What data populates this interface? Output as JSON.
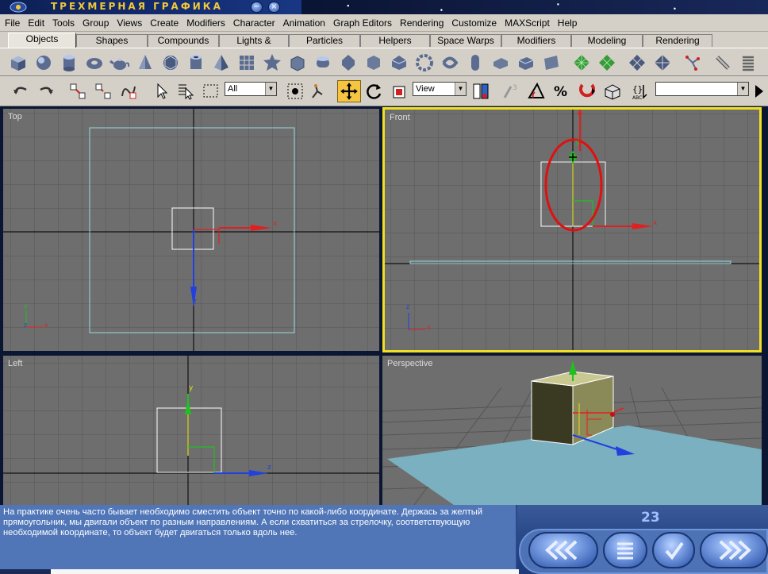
{
  "window": {
    "title": "ТРЕХМЕРНАЯ ГРАФИКА",
    "min_label": "−",
    "close_label": "×"
  },
  "menu": [
    "File",
    "Edit",
    "Tools",
    "Group",
    "Views",
    "Create",
    "Modifiers",
    "Character",
    "Animation",
    "Graph Editors",
    "Rendering",
    "Customize",
    "MAXScript",
    "Help"
  ],
  "tabs": [
    {
      "label": "Objects",
      "active": true
    },
    {
      "label": "Shapes"
    },
    {
      "label": "Compounds"
    },
    {
      "label": "Lights & Cameras"
    },
    {
      "label": "Particles"
    },
    {
      "label": "Helpers"
    },
    {
      "label": "Space Warps"
    },
    {
      "label": "Modifiers"
    },
    {
      "label": "Modeling"
    },
    {
      "label": "Rendering"
    }
  ],
  "icons": [
    "box-icon",
    "sphere-icon",
    "cylinder-icon",
    "torus-icon",
    "teapot-icon",
    "cone-icon",
    "geosphere-icon",
    "tube-icon",
    "pyramid-icon",
    "plane-icon",
    "hedra-icon",
    "chamferbox-icon",
    "oiltank-icon",
    "spindle-icon",
    "gengon-icon",
    "prism-icon",
    "torusknot-icon",
    "ringwave-icon",
    "hose-icon",
    "capsule-icon",
    "l-ext-icon",
    "c-ext-icon",
    "wall-icon",
    "grid-icon",
    "grid2-icon",
    "patch-icon",
    "patch2-icon",
    "bones-icon",
    "pencil-icon",
    "spring-icon"
  ],
  "toolbar": {
    "filter_value": "All",
    "refcoord_value": "View",
    "named_sel_value": "",
    "tools": [
      "undo-icon",
      "redo-icon",
      "link-icon",
      "unlink-icon",
      "bind-icon",
      "select-icon",
      "select-by-name-icon",
      "rect-region-icon",
      "select-move-icon",
      "select-rotate-icon",
      "select-scale-icon",
      "pivot-icon",
      "manipulate-icon",
      "snap-icon",
      "angle-snap-icon",
      "percent-snap-icon",
      "spinner-snap-icon",
      "named-sel-icon",
      "mirror-icon",
      "align-icon"
    ]
  },
  "viewports": [
    {
      "label": "Top",
      "active": false
    },
    {
      "label": "Front",
      "active": true
    },
    {
      "label": "Left",
      "active": false
    },
    {
      "label": "Perspective",
      "active": false
    }
  ],
  "axes": {
    "x": "x",
    "y": "y",
    "z": "z"
  },
  "caption": "На практике очень часто бывает необходимо сместить объект точно по какой-либо координате. Держась за желтый прямоугольник, мы двигали объект по разным направлениям. А если схватиться за стрелочку, соответствующую необходимой координате, то объект будет двигаться только вдоль нее.",
  "page_number": "23",
  "colors": {
    "active_viewport": "#f0e020",
    "gizmo_x": "#e02020",
    "gizmo_y": "#20c020",
    "gizmo_z": "#2040e0",
    "highlight_ring": "#e01010",
    "plane": "#7ab0c0",
    "box": "#3a3a22"
  }
}
